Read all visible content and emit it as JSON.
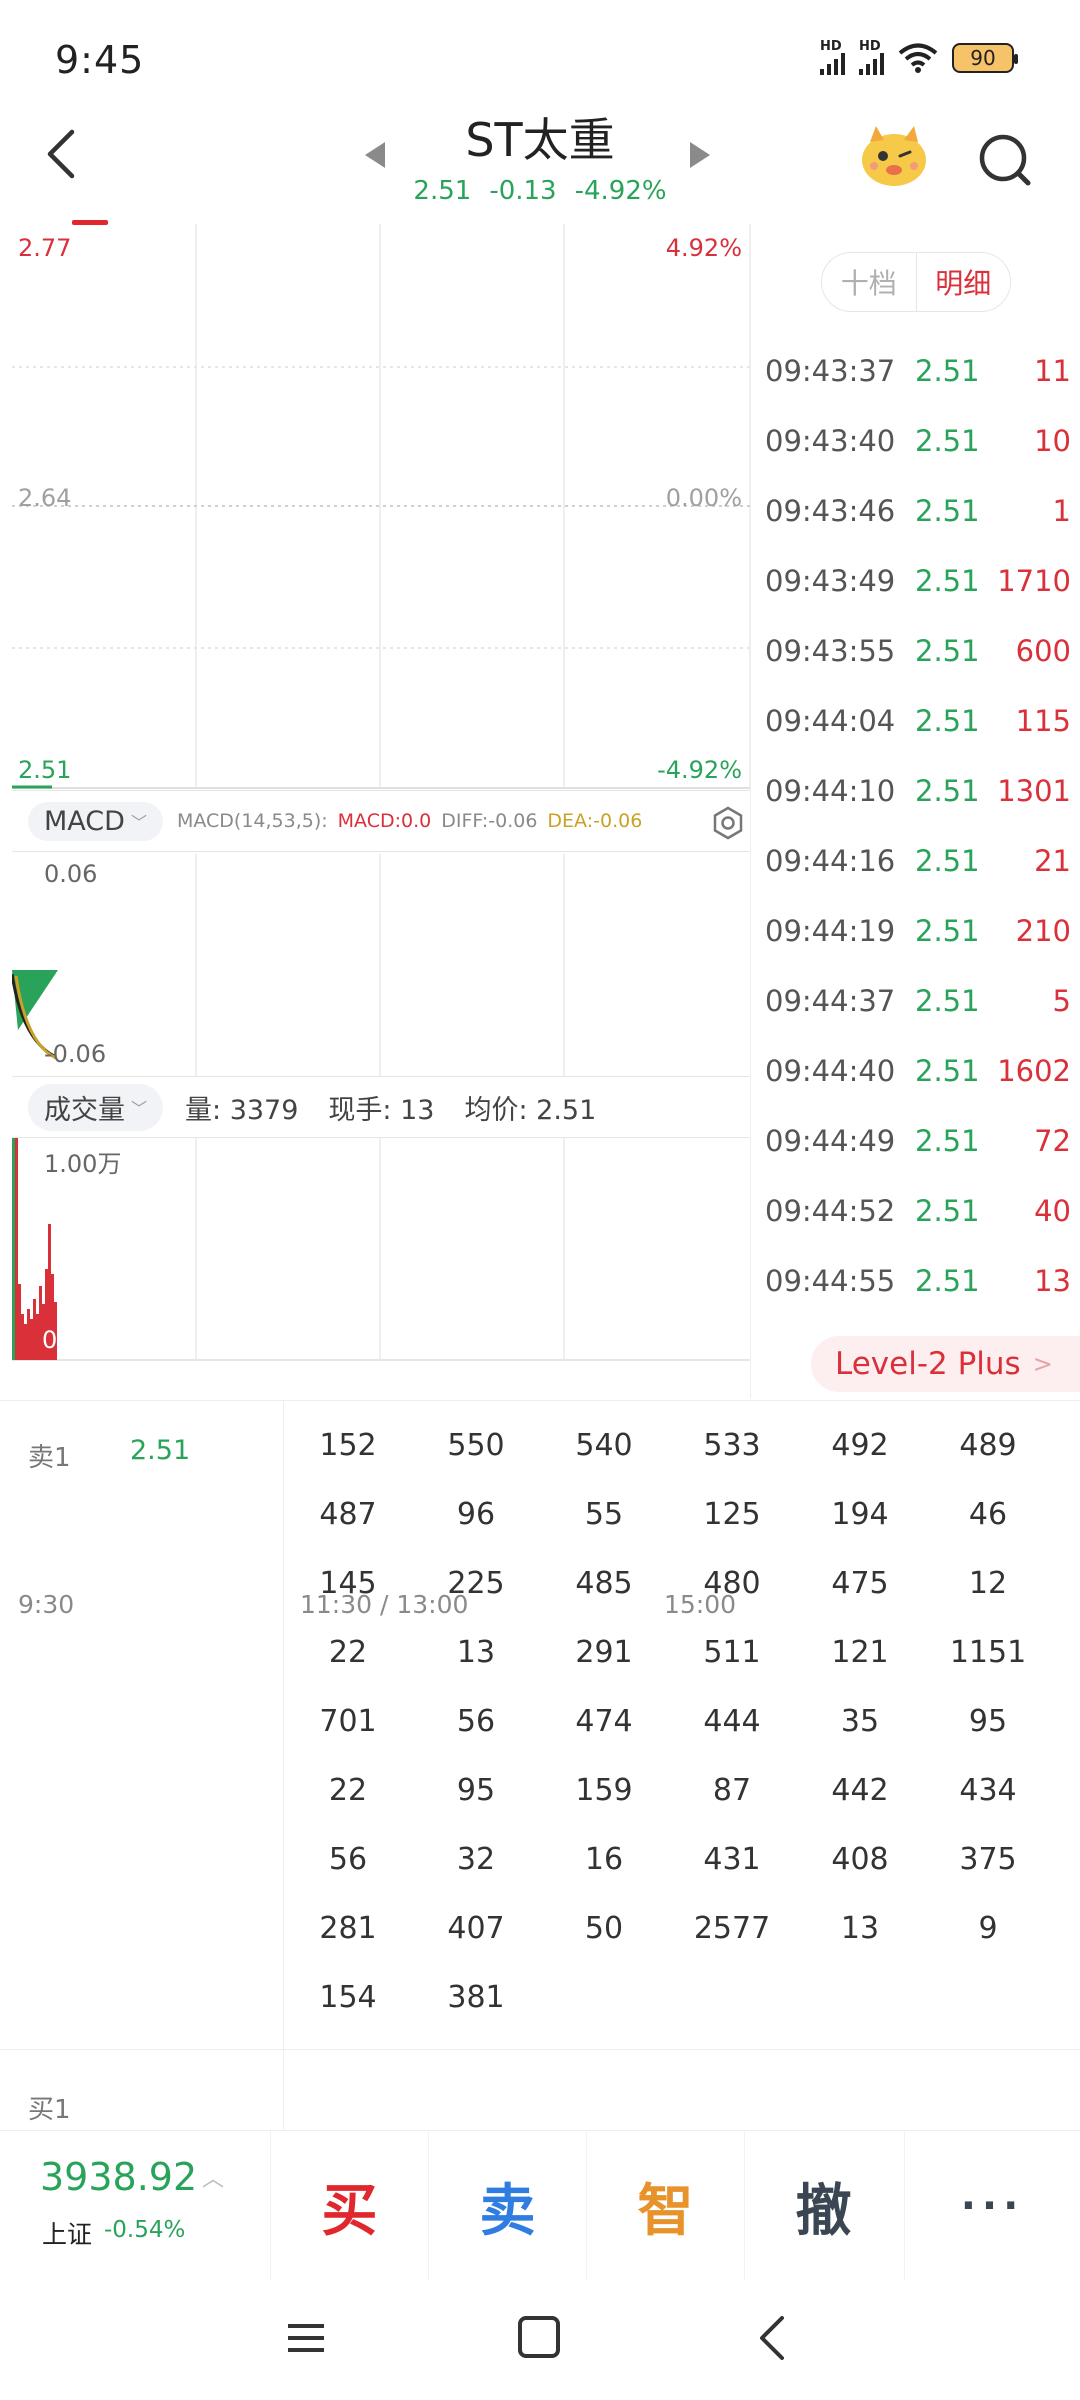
{
  "status_bar": {
    "time": "9:45",
    "battery": "90"
  },
  "header": {
    "title": "ST太重",
    "price": "2.51",
    "change": "-0.13",
    "change_pct": "-4.92%"
  },
  "chart": {
    "price_high": "2.77",
    "pct_high": "4.92%",
    "price_mid": "2.64",
    "pct_mid": "0.00%",
    "price_low": "2.51",
    "pct_low": "-4.92%",
    "macd": {
      "selector": "MACD",
      "params": "MACD(14,53,5):",
      "macd_value": "MACD:0.0",
      "diff_value": "DIFF:-0.06",
      "dea_value": "DEA:-0.06",
      "top_label": "0.06",
      "bottom_label": "-0.06"
    },
    "volume": {
      "selector": "成交量",
      "amount": "量: 3379",
      "current": "现手: 13",
      "avg_price": "均价: 2.51",
      "top_label": "1.00万",
      "zero_label": "0"
    },
    "time_axis": {
      "start": "9:30",
      "mid": "11:30 / 13:00",
      "end": "15:00"
    }
  },
  "ticks_panel": {
    "tab_ten": "十档",
    "tab_detail": "明细",
    "rows": [
      {
        "time": "09:43:37",
        "price": "2.51",
        "vol": "11"
      },
      {
        "time": "09:43:40",
        "price": "2.51",
        "vol": "10"
      },
      {
        "time": "09:43:46",
        "price": "2.51",
        "vol": "1"
      },
      {
        "time": "09:43:49",
        "price": "2.51",
        "vol": "1710"
      },
      {
        "time": "09:43:55",
        "price": "2.51",
        "vol": "600"
      },
      {
        "time": "09:44:04",
        "price": "2.51",
        "vol": "115"
      },
      {
        "time": "09:44:10",
        "price": "2.51",
        "vol": "1301"
      },
      {
        "time": "09:44:16",
        "price": "2.51",
        "vol": "21"
      },
      {
        "time": "09:44:19",
        "price": "2.51",
        "vol": "210"
      },
      {
        "time": "09:44:37",
        "price": "2.51",
        "vol": "5"
      },
      {
        "time": "09:44:40",
        "price": "2.51",
        "vol": "1602"
      },
      {
        "time": "09:44:49",
        "price": "2.51",
        "vol": "72"
      },
      {
        "time": "09:44:52",
        "price": "2.51",
        "vol": "40"
      },
      {
        "time": "09:44:55",
        "price": "2.51",
        "vol": "13"
      }
    ],
    "level2_label": "Level-2 Plus"
  },
  "order_queue": {
    "sell1_label": "卖1",
    "sell1_price": "2.51",
    "orders": [
      "152",
      "550",
      "540",
      "533",
      "492",
      "489",
      "487",
      "96",
      "55",
      "125",
      "194",
      "46",
      "145",
      "225",
      "485",
      "480",
      "475",
      "12",
      "22",
      "13",
      "291",
      "511",
      "121",
      "1151",
      "701",
      "56",
      "474",
      "444",
      "35",
      "95",
      "22",
      "95",
      "159",
      "87",
      "442",
      "434",
      "56",
      "32",
      "16",
      "431",
      "408",
      "375",
      "281",
      "407",
      "50",
      "2577",
      "13",
      "9",
      "154",
      "381"
    ],
    "buy1_label": "买1"
  },
  "trade_bar": {
    "index_value": "3938.92",
    "index_name": "上证",
    "index_change": "-0.54%",
    "buy": "买",
    "sell": "卖",
    "smart": "智",
    "cancel": "撤",
    "more": "···"
  }
}
